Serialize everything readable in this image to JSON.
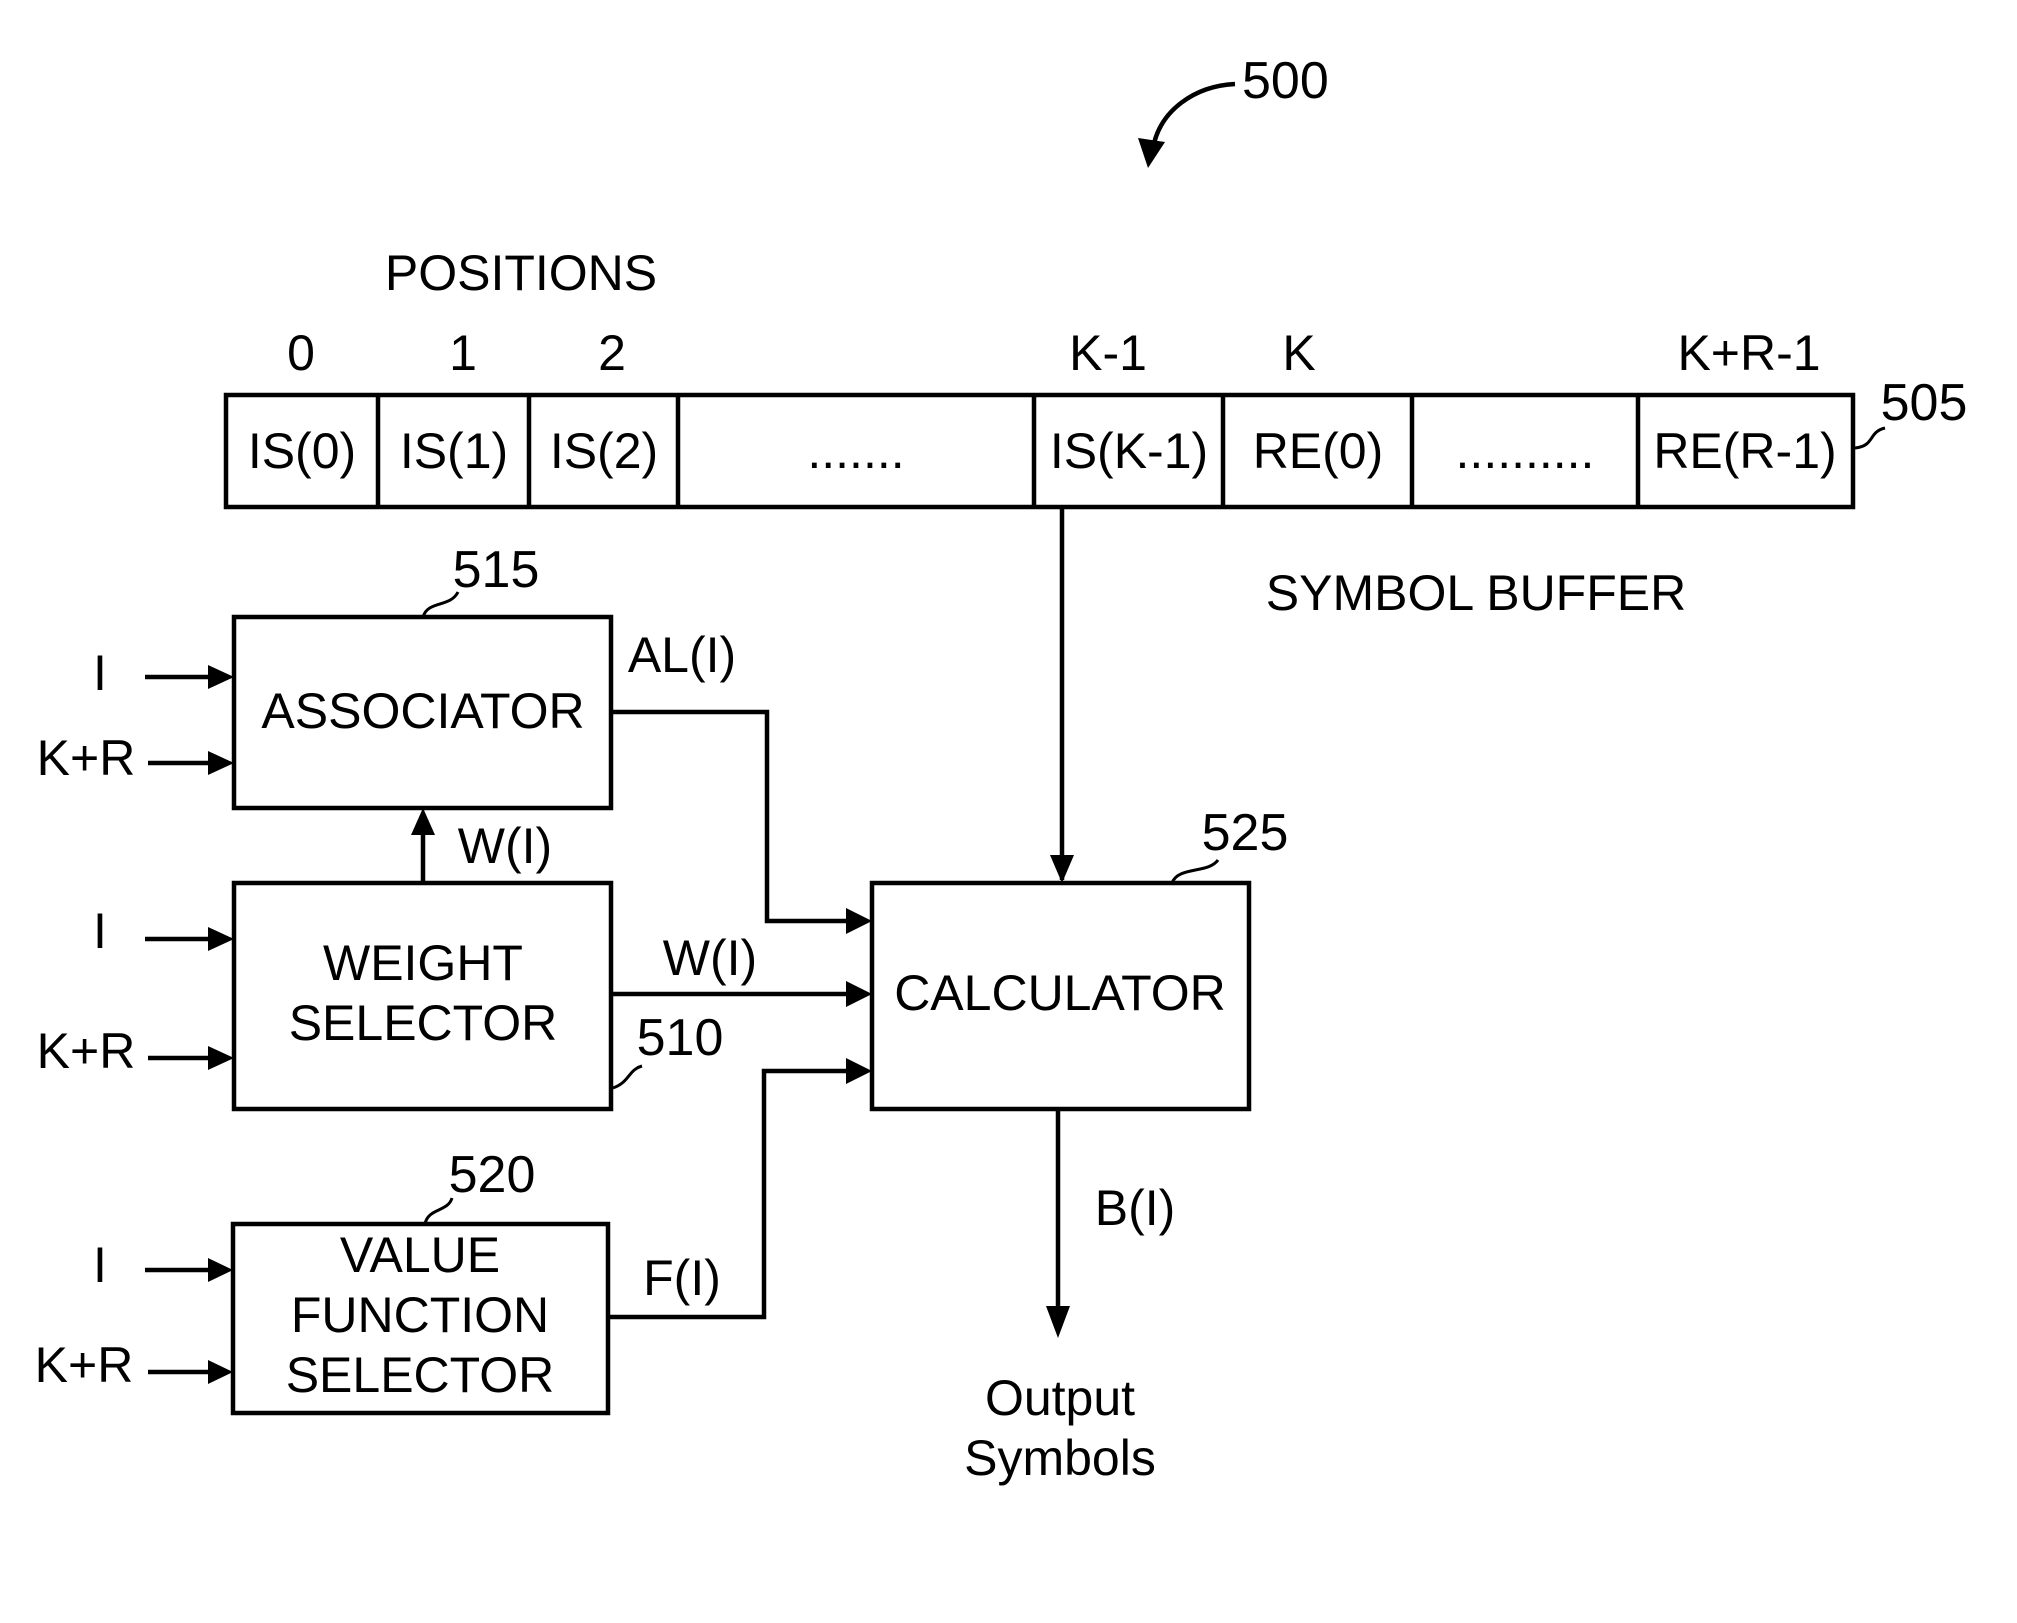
{
  "figure": {
    "ref_number": "500"
  },
  "symbol_buffer": {
    "ref_number": "505",
    "title": "SYMBOL BUFFER",
    "positions_heading": "POSITIONS",
    "positions": [
      "0",
      "1",
      "2",
      "K-1",
      "K",
      "K+R-1"
    ],
    "cells": [
      "IS(0)",
      "IS(1)",
      "IS(2)",
      ".......",
      "IS(K-1)",
      "RE(0)",
      "..........",
      "RE(R-1)"
    ]
  },
  "associator": {
    "ref_number": "515",
    "label": "ASSOCIATOR",
    "inputs": [
      "I",
      "K+R"
    ],
    "output_label": "AL(I)"
  },
  "weight_selector": {
    "ref_number": "510",
    "label_lines": [
      "WEIGHT",
      "SELECTOR"
    ],
    "inputs": [
      "I",
      "K+R"
    ],
    "output_to_associator_label": "W(I)",
    "output_to_calculator_label": "W(I)"
  },
  "value_function_selector": {
    "ref_number": "520",
    "label_lines": [
      "VALUE",
      "FUNCTION",
      "SELECTOR"
    ],
    "inputs": [
      "I",
      "K+R"
    ],
    "output_label": "F(I)"
  },
  "calculator": {
    "ref_number": "525",
    "label": "CALCULATOR",
    "output_label": "B(I)"
  },
  "output": {
    "label_lines": [
      "Output",
      "Symbols"
    ]
  }
}
